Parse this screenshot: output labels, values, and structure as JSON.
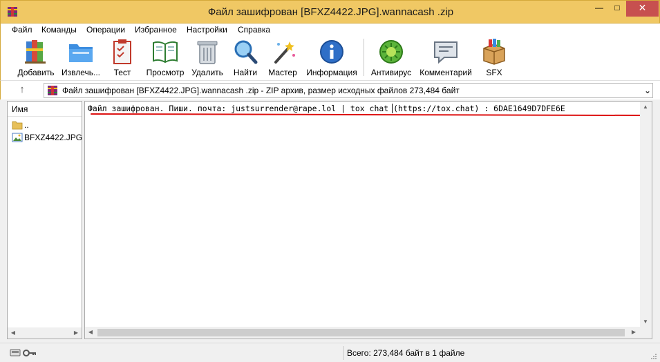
{
  "window": {
    "title": "Файл зашифрован [BFXZ4422.JPG].wannacash .zip",
    "min_glyph": "—",
    "max_glyph": "□",
    "close_glyph": "✕"
  },
  "menu": [
    "Файл",
    "Команды",
    "Операции",
    "Избранное",
    "Настройки",
    "Справка"
  ],
  "toolbar": {
    "buttons": [
      {
        "label": "Добавить",
        "icon": "books-add-icon"
      },
      {
        "label": "Извлечь...",
        "icon": "folder-extract-icon"
      },
      {
        "label": "Тест",
        "icon": "clipboard-test-icon"
      },
      {
        "label": "Просмотр",
        "icon": "book-view-icon"
      },
      {
        "label": "Удалить",
        "icon": "trash-icon"
      },
      {
        "label": "Найти",
        "icon": "magnifier-icon"
      },
      {
        "label": "Мастер",
        "icon": "magic-wand-icon"
      },
      {
        "label": "Информация",
        "icon": "info-icon"
      },
      {
        "label": "Антивирус",
        "icon": "antivirus-icon"
      },
      {
        "label": "Комментарий",
        "icon": "comment-icon"
      },
      {
        "label": "SFX",
        "icon": "sfx-box-icon"
      }
    ]
  },
  "address": {
    "up_glyph": "↑",
    "text": "Файл зашифрован [BFXZ4422.JPG].wannacash .zip - ZIP архив, размер исходных файлов 273,484 байт",
    "dropdown_glyph": "⌄"
  },
  "filelist": {
    "column_name": "Имя",
    "rows": [
      {
        "name": "..",
        "icon": "folder-icon"
      },
      {
        "name": "BFXZ4422.JPG *",
        "icon": "image-file-icon"
      }
    ]
  },
  "comment": {
    "text": "Файл зашифрован. Пиши. почта: justsurrender@rape.lol | tox chat (https://tox.chat) : 6DAE1649D7DFE6E"
  },
  "status": {
    "text": "Всего: 273,484 байт в 1 файле"
  },
  "colors": {
    "titlebar": "#f0c864",
    "close": "#c7504f",
    "annotation": "#dd1111"
  }
}
